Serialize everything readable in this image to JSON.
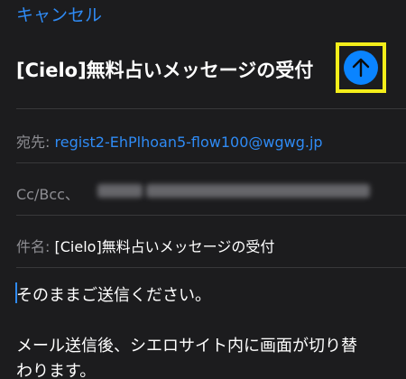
{
  "header": {
    "cancel_label": "キャンセル",
    "title": "[Cielo]無料占いメッセージの受付",
    "send_icon": "arrow-up-icon"
  },
  "fields": {
    "to_label": "宛先:",
    "to_value": "regist2-EhPlhoan5-flow100@wgwg.jp",
    "cc_label": "Cc/Bcc、",
    "subject_label": "件名:",
    "subject_value": "[Cielo]無料占いメッセージの受付"
  },
  "body": {
    "line1": "そのままご送信ください。",
    "line2": "メール送信後、シエロサイト内に画面が切り替",
    "line3": "わります。"
  },
  "colors": {
    "background": "#1c1c1e",
    "accent": "#0a84ff",
    "link": "#2f8bf5",
    "highlight": "#f4ee1a"
  }
}
